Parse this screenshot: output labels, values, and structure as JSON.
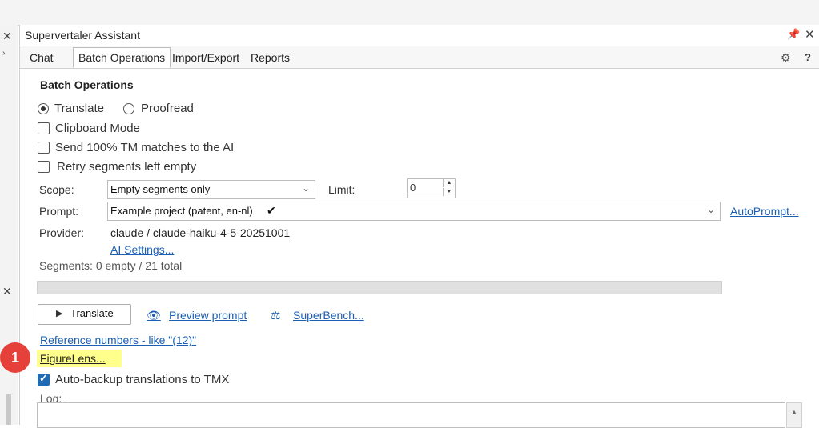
{
  "window": {
    "title": "Supervertaler Assistant"
  },
  "tabs": [
    {
      "label": "Chat",
      "active": false
    },
    {
      "label": "Batch Operations",
      "active": true
    },
    {
      "label": "Import/Export",
      "active": false
    },
    {
      "label": "Reports",
      "active": false
    }
  ],
  "section_title": "Batch Operations",
  "mode": {
    "translate": "Translate",
    "proofread": "Proofread",
    "selected": "translate"
  },
  "options": {
    "clipboard_mode": "Clipboard Mode",
    "send_tm": "Send 100% TM matches to the AI",
    "retry_empty": "Retry segments left empty"
  },
  "scope": {
    "label": "Scope:",
    "value": "Empty segments only"
  },
  "limit": {
    "label": "Limit:",
    "value": "0"
  },
  "prompt": {
    "label": "Prompt:",
    "value": "Example project (patent, en-nl)",
    "check": "✔"
  },
  "autoprompt_link": "AutoPrompt...",
  "provider": {
    "label": "Provider:",
    "value": "claude / claude-haiku-4-5-20251001"
  },
  "ai_settings_link": "AI Settings...",
  "segments_text": "Segments: 0 empty / 21 total",
  "progress": 0,
  "actions": {
    "translate_button": "Translate",
    "preview_prompt": "Preview prompt",
    "superbench": "SuperBench..."
  },
  "links": {
    "reference_numbers": "Reference numbers - like \"(12)\"",
    "figurelens": "FigureLens..."
  },
  "auto_backup": "Auto-backup translations to TMX",
  "log_label": "Log:",
  "annotation_badge": "1",
  "colors": {
    "accent": "#1f6ab5",
    "highlight": "#ffff8c",
    "badge": "#e5403a"
  },
  "icons": {
    "close": "close-icon",
    "pin": "pin-icon",
    "gear": "gear-icon",
    "help": "help-icon",
    "play": "play-icon",
    "eye": "eye-icon",
    "scale": "scale-icon"
  }
}
